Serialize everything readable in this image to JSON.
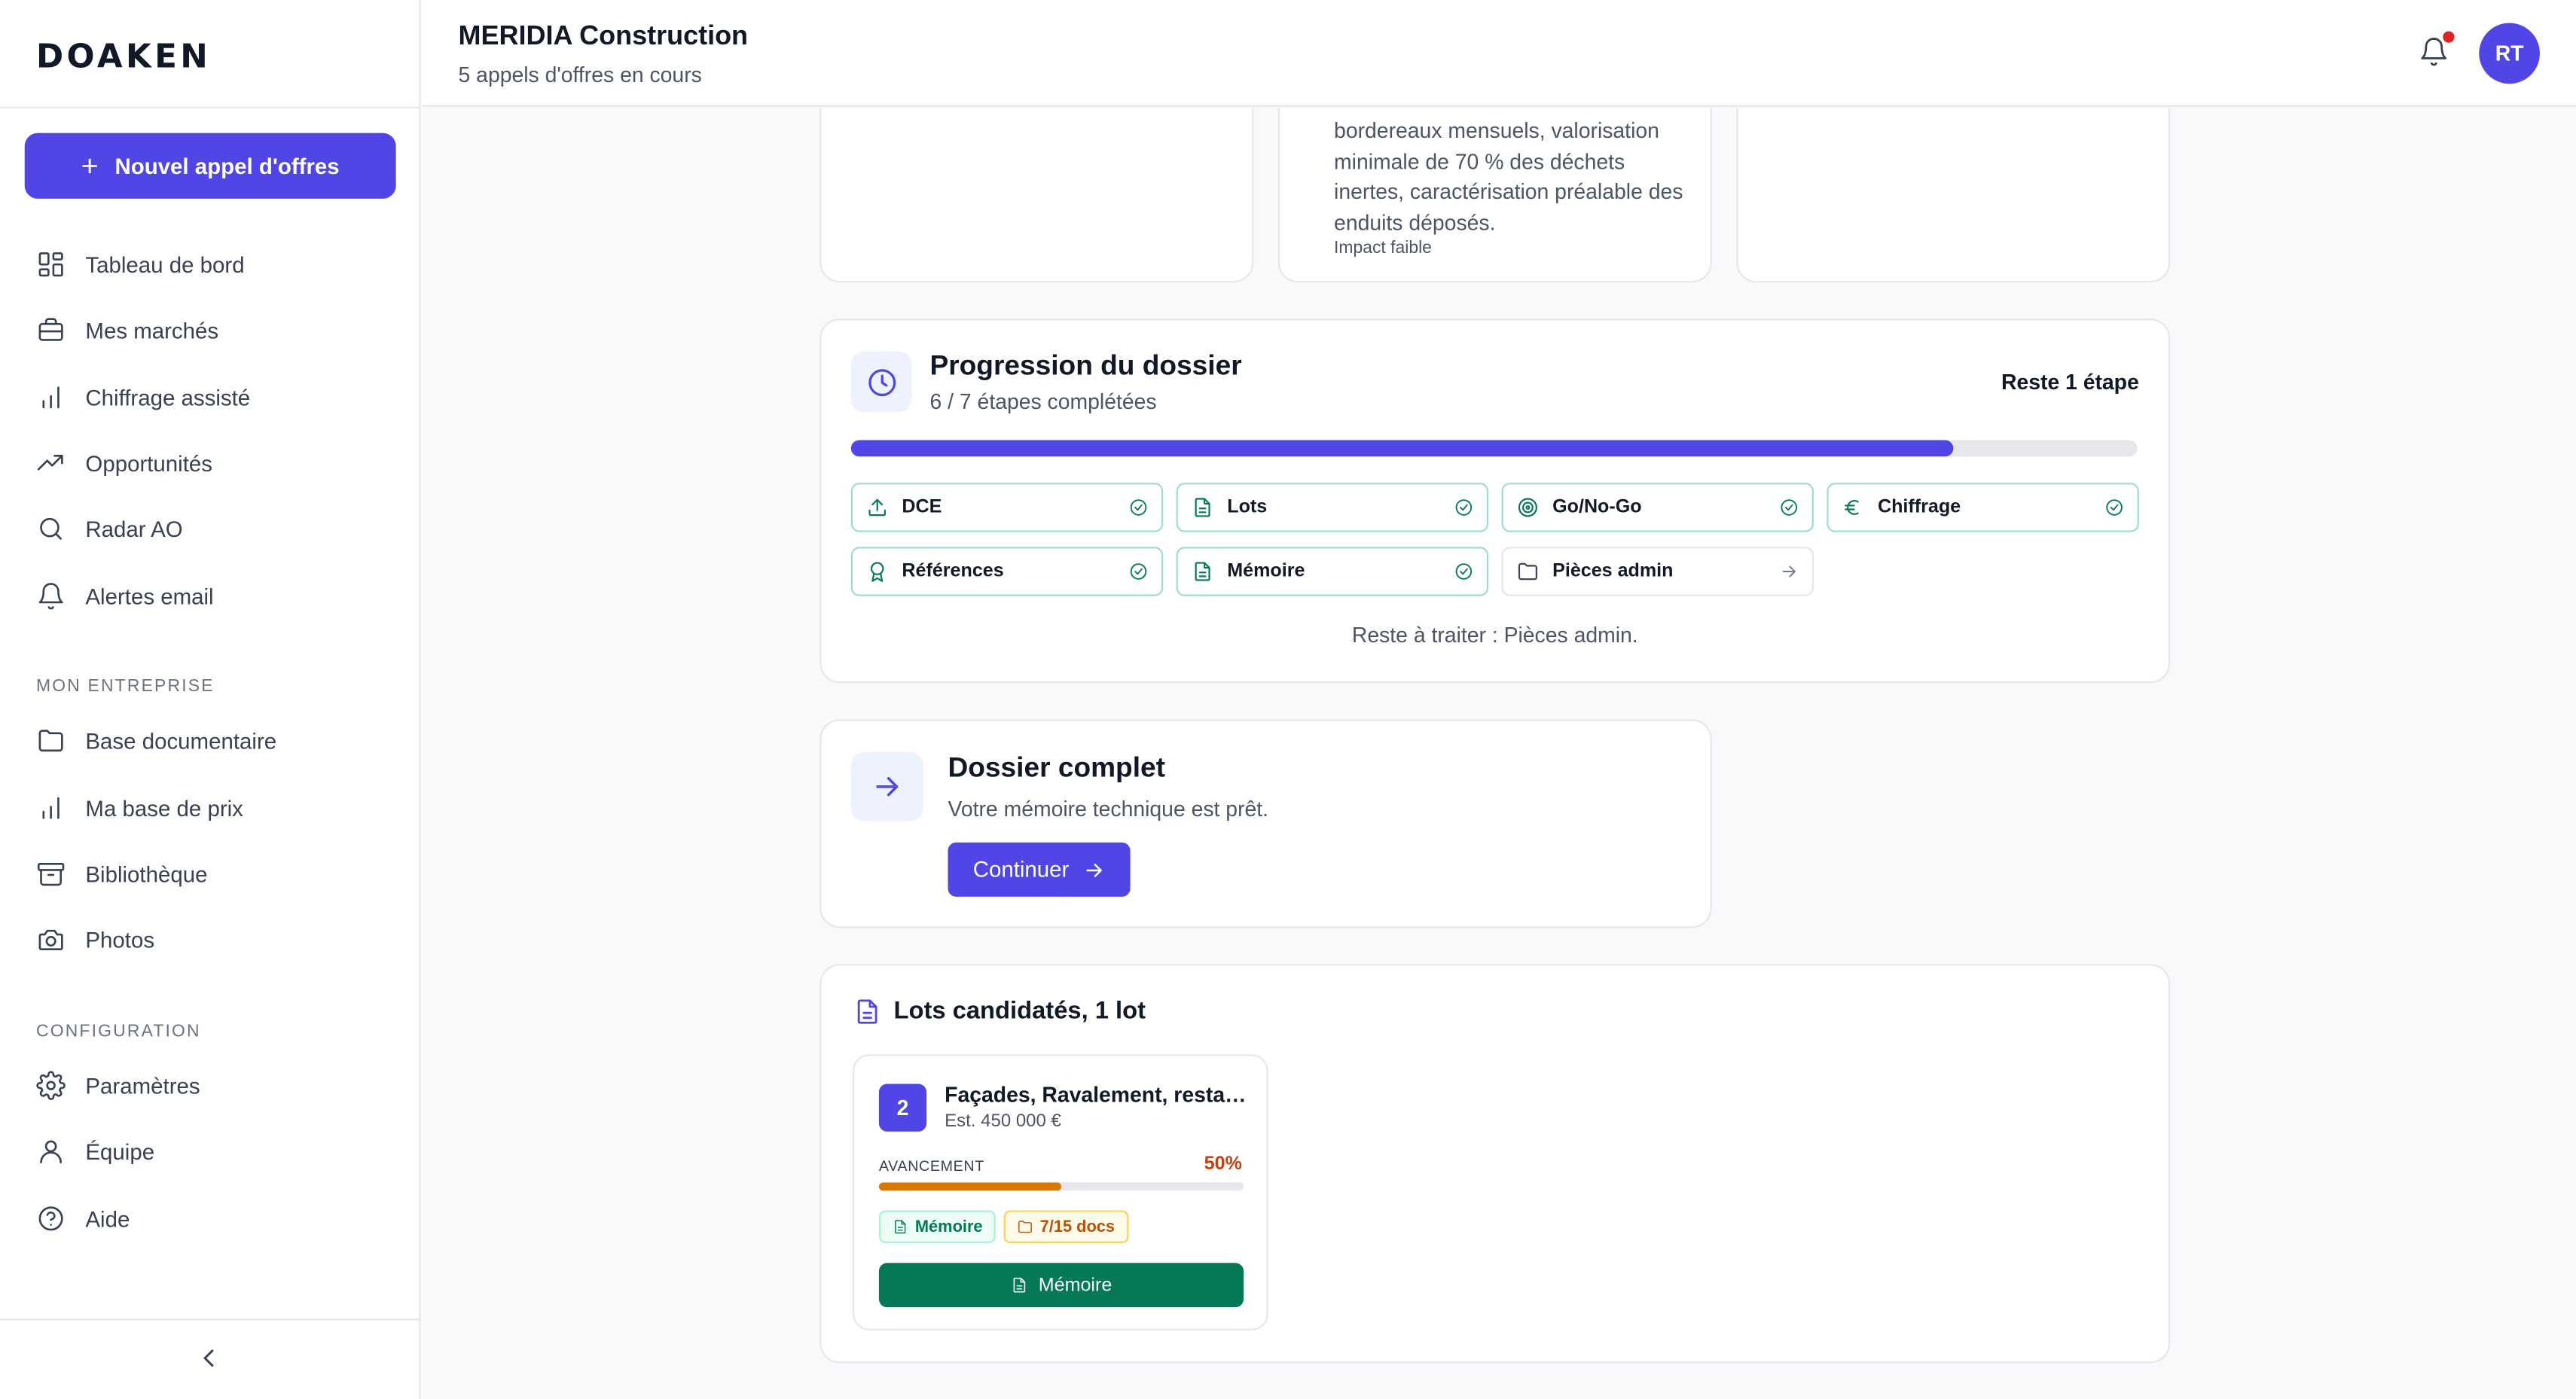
{
  "app": {
    "logo": "DOAKEN"
  },
  "sidebar": {
    "new_button": "Nouvel appel d'offres",
    "main_items": [
      {
        "label": "Tableau de bord",
        "icon": "dashboard-icon"
      },
      {
        "label": "Mes marchés",
        "icon": "briefcase-icon"
      },
      {
        "label": "Chiffrage assisté",
        "icon": "bar-chart-icon"
      },
      {
        "label": "Opportunités",
        "icon": "trending-up-icon"
      },
      {
        "label": "Radar AO",
        "icon": "search-icon"
      },
      {
        "label": "Alertes email",
        "icon": "bell-icon"
      }
    ],
    "section_company": "MON ENTREPRISE",
    "company_items": [
      {
        "label": "Base documentaire",
        "icon": "folder-icon"
      },
      {
        "label": "Ma base de prix",
        "icon": "bar-chart-icon"
      },
      {
        "label": "Bibliothèque",
        "icon": "archive-icon"
      },
      {
        "label": "Photos",
        "icon": "camera-icon"
      }
    ],
    "section_config": "CONFIGURATION",
    "config_items": [
      {
        "label": "Paramètres",
        "icon": "gear-icon"
      },
      {
        "label": "Équipe",
        "icon": "user-icon"
      },
      {
        "label": "Aide",
        "icon": "help-circle-icon"
      }
    ]
  },
  "header": {
    "title": "MERIDIA Construction",
    "subtitle": "5 appels d'offres en cours",
    "avatar_initials": "RT"
  },
  "top_card": {
    "text": "bordereaux mensuels, valorisation minimale de 70 % des déchets inertes, caractérisation préalable des enduits déposés.",
    "impact": "Impact faible"
  },
  "progress": {
    "title": "Progression du dossier",
    "subtitle": "6 / 7 étapes complétées",
    "remaining": "Reste 1 étape",
    "fraction": 0.857,
    "steps": [
      {
        "label": "DCE",
        "icon": "upload-icon",
        "done": true
      },
      {
        "label": "Lots",
        "icon": "file-text-icon",
        "done": true
      },
      {
        "label": "Go/No-Go",
        "icon": "target-icon",
        "done": true
      },
      {
        "label": "Chiffrage",
        "icon": "euro-icon",
        "done": true
      },
      {
        "label": "Références",
        "icon": "award-icon",
        "done": true
      },
      {
        "label": "Mémoire",
        "icon": "file-text-icon",
        "done": true
      },
      {
        "label": "Pièces admin",
        "icon": "folder-icon",
        "done": false
      }
    ],
    "footer": "Reste à traiter : Pièces admin."
  },
  "continue_card": {
    "title": "Dossier complet",
    "subtitle": "Votre mémoire technique est prêt.",
    "button": "Continuer"
  },
  "lots": {
    "title": "Lots candidatés, 1 lot",
    "items": [
      {
        "number": "2",
        "name": "Façades, Ravalement, restauration",
        "estimate": "Est. 450 000 €",
        "progress_label": "AVANCEMENT",
        "progress_value": "50%",
        "progress_fraction": 0.5,
        "tag_memoire": "Mémoire",
        "tag_docs": "7/15 docs",
        "button": "Mémoire"
      }
    ]
  },
  "colors": {
    "accent": "#4f46e5",
    "success": "#047857",
    "warning": "#d97706",
    "alert": "#dc2626"
  }
}
